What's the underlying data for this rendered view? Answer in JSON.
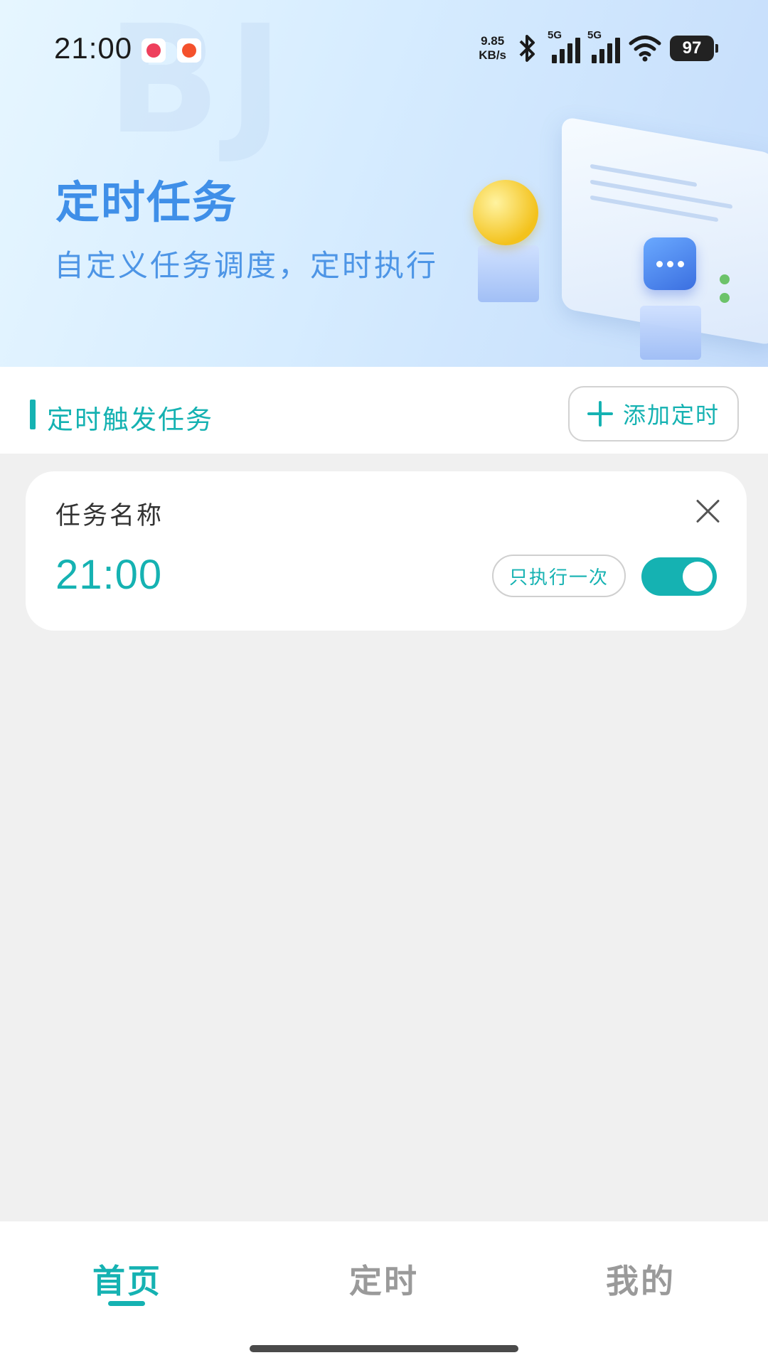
{
  "status_bar": {
    "time": "21:00",
    "net_speed_value": "9.85",
    "net_speed_unit": "KB/s",
    "signal_1_label": "5G",
    "signal_2_label": "5G",
    "battery": "97"
  },
  "hero": {
    "title": "定时任务",
    "subtitle": "自定义任务调度，定时执行"
  },
  "section": {
    "title": "定时触发任务",
    "add_button_label": "添加定时"
  },
  "tasks": [
    {
      "name": "任务名称",
      "time": "21:00",
      "repeat_label": "只执行一次",
      "enabled": true
    }
  ],
  "bottom_nav": {
    "items": [
      {
        "label": "首页",
        "active": true
      },
      {
        "label": "定时",
        "active": false
      },
      {
        "label": "我的",
        "active": false
      }
    ]
  },
  "colors": {
    "accent": "#15b2b2",
    "hero_title": "#3f8fe8"
  }
}
